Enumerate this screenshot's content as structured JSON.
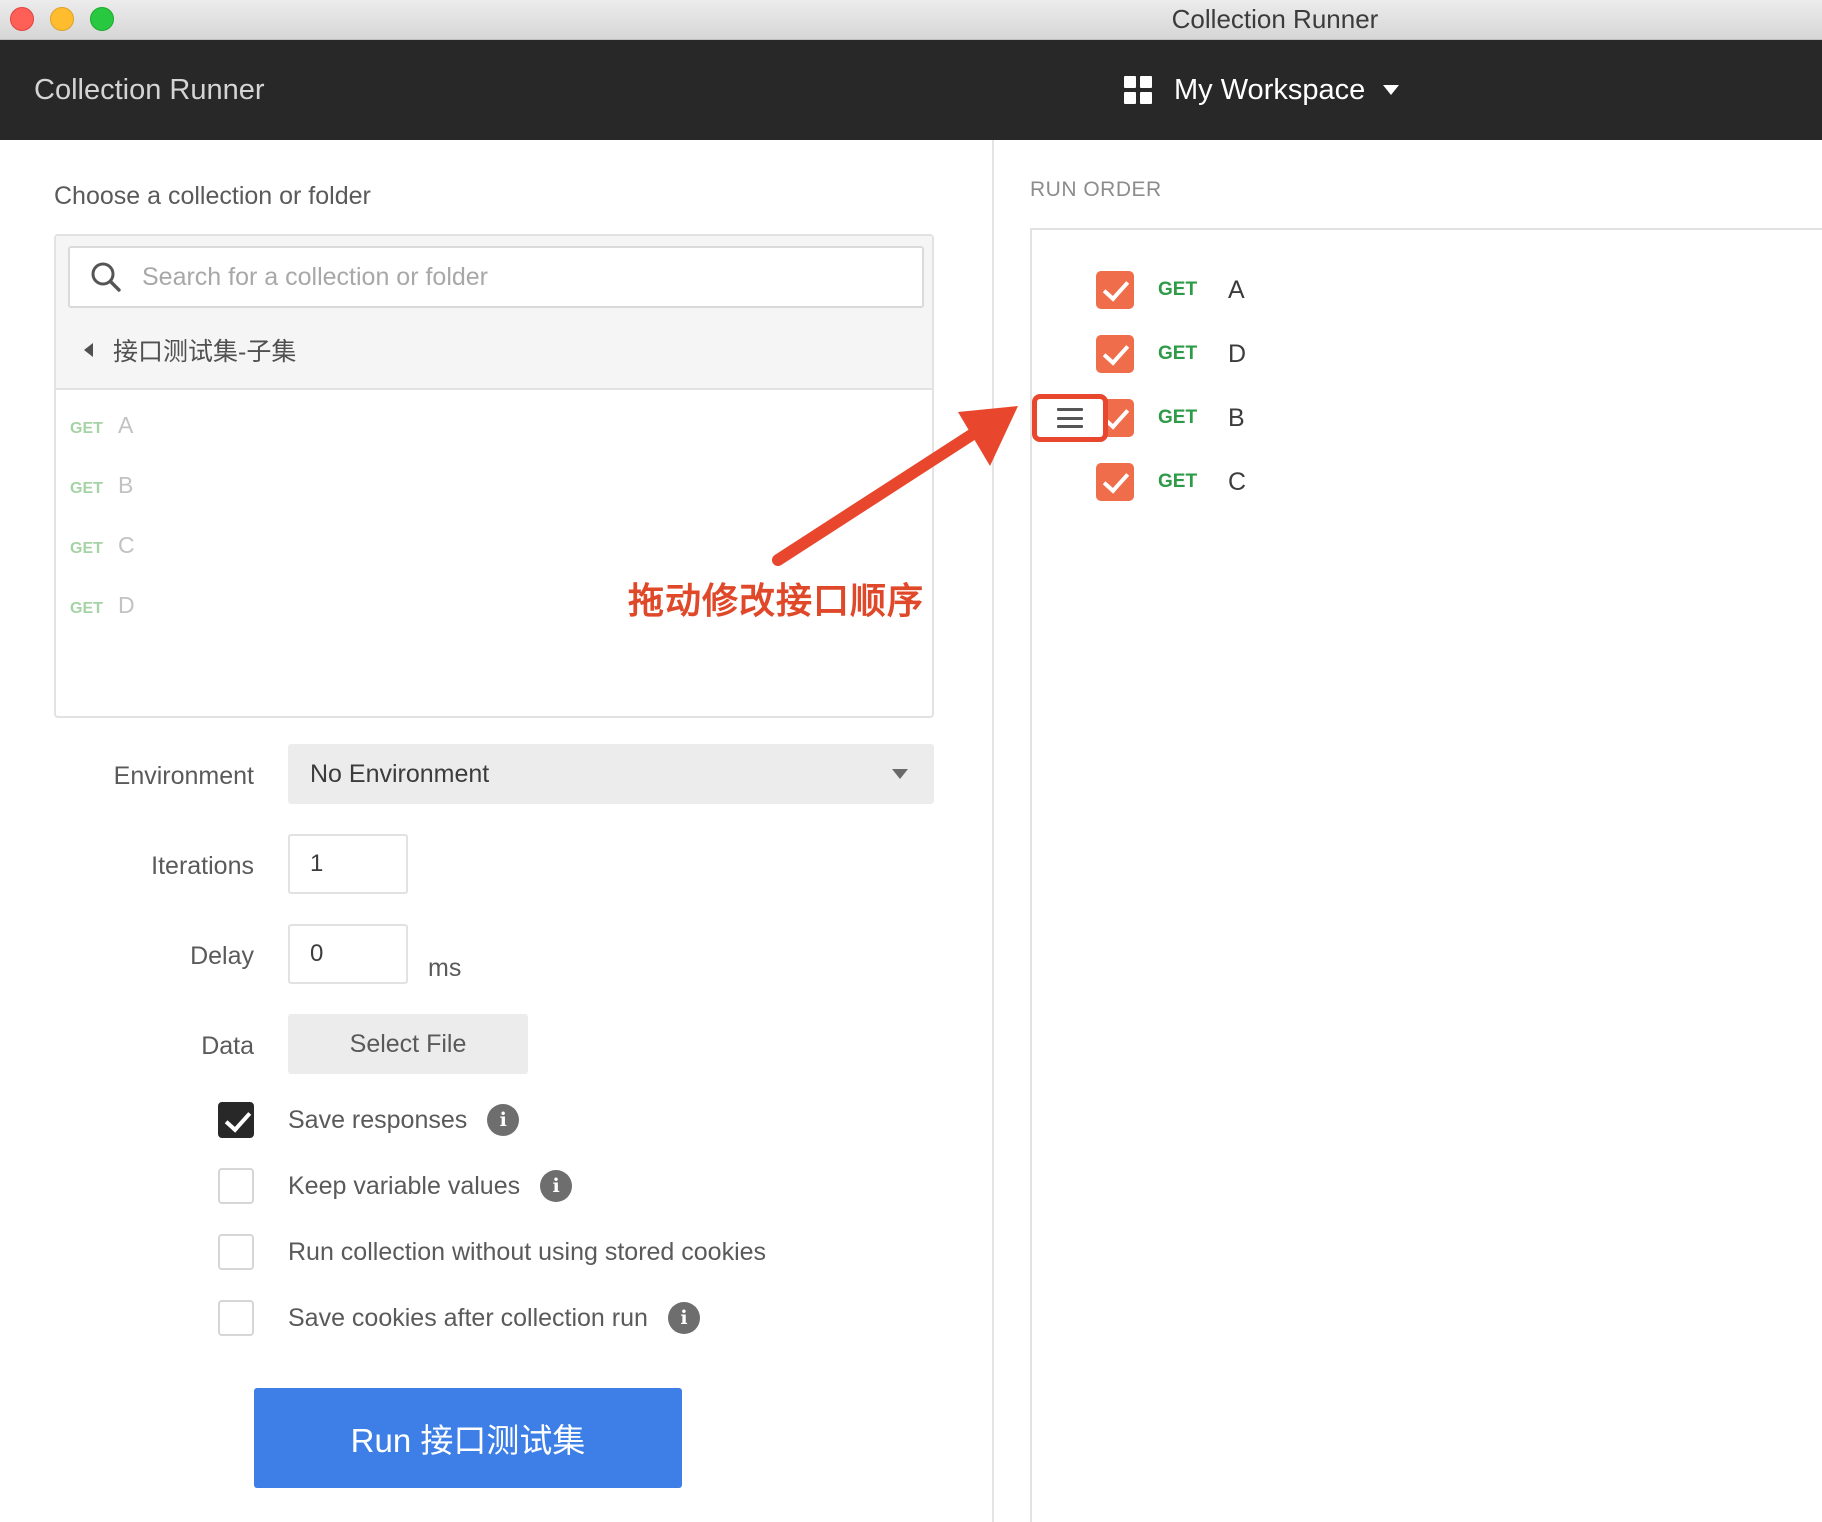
{
  "window": {
    "title": "Collection Runner"
  },
  "header": {
    "app_title": "Collection Runner",
    "workspace_label": "My Workspace"
  },
  "collection_picker": {
    "label": "Choose a collection or folder",
    "search_placeholder": "Search for a collection or folder",
    "current_folder": "接口测试集-子集",
    "requests": [
      {
        "method": "GET",
        "name": "A"
      },
      {
        "method": "GET",
        "name": "B"
      },
      {
        "method": "GET",
        "name": "C"
      },
      {
        "method": "GET",
        "name": "D"
      }
    ]
  },
  "settings": {
    "environment_label": "Environment",
    "environment_value": "No Environment",
    "iterations_label": "Iterations",
    "iterations_value": "1",
    "delay_label": "Delay",
    "delay_value": "0",
    "delay_unit": "ms",
    "data_label": "Data",
    "select_file_label": "Select File"
  },
  "options": [
    {
      "label": "Save responses",
      "checked": true,
      "has_info": true
    },
    {
      "label": "Keep variable values",
      "checked": false,
      "has_info": true
    },
    {
      "label": "Run collection without using stored cookies",
      "checked": false,
      "has_info": false
    },
    {
      "label": "Save cookies after collection run",
      "checked": false,
      "has_info": true
    }
  ],
  "run_button_label": "Run 接口测试集",
  "run_order": {
    "label": "RUN ORDER",
    "items": [
      {
        "method": "GET",
        "name": "A",
        "checked": true
      },
      {
        "method": "GET",
        "name": "D",
        "checked": true
      },
      {
        "method": "GET",
        "name": "B",
        "checked": true
      },
      {
        "method": "GET",
        "name": "C",
        "checked": true
      }
    ]
  },
  "annotation": {
    "text": "拖动修改接口顺序",
    "color": "#e0482a"
  },
  "colors": {
    "header_bg": "#282828",
    "accent_blue": "#3d7fe6",
    "checkbox_orange": "#ef6d4a",
    "method_green": "#2f9a47"
  }
}
